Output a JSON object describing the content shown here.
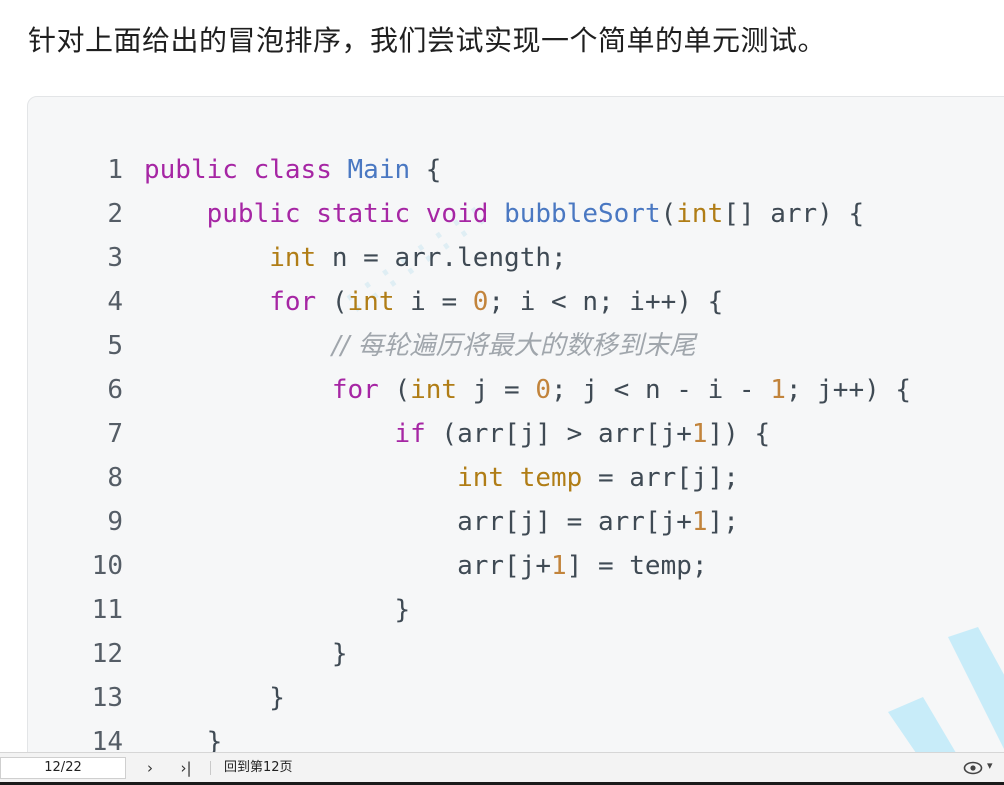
{
  "intro_text": "针对上面给出的冒泡排序，我们尝试实现一个简单的单元测试。",
  "code": {
    "lines": [
      {
        "num": "1"
      },
      {
        "num": "2"
      },
      {
        "num": "3"
      },
      {
        "num": "4"
      },
      {
        "num": "5"
      },
      {
        "num": "6"
      },
      {
        "num": "7"
      },
      {
        "num": "8"
      },
      {
        "num": "9"
      },
      {
        "num": "10"
      },
      {
        "num": "11"
      },
      {
        "num": "12"
      },
      {
        "num": "13"
      },
      {
        "num": "14"
      }
    ],
    "tokens": {
      "l1_public": "public",
      "l1_class": "class",
      "l1_main": "Main",
      "l1_brace": "{",
      "l2_public": "public",
      "l2_static": "static",
      "l2_void": "void",
      "l2_fn": "bubbleSort",
      "l2_paren_open": "(",
      "l2_int": "int",
      "l2_rest": "[] arr) {",
      "l3_int": "int",
      "l3_rest": "n = arr.length;",
      "l4_for": "for",
      "l4_a": "(",
      "l4_int": "int",
      "l4_b": "i = ",
      "l4_zero": "0",
      "l4_c": "; i < n; i++) {",
      "l5_comment": "// 每轮遍历将最大的数移到末尾",
      "l6_for": "for",
      "l6_a": "(",
      "l6_int": "int",
      "l6_b": "j = ",
      "l6_zero": "0",
      "l6_c": "; j < n - i - ",
      "l6_one": "1",
      "l6_d": "; j++) {",
      "l7_if": "if",
      "l7_a": "(arr[j] > arr[j+",
      "l7_one": "1",
      "l7_b": "]) {",
      "l8_int": "int",
      "l8_temp": "temp",
      "l8_rest": "= arr[j];",
      "l9_a": "arr[j] = arr[j+",
      "l9_one": "1",
      "l9_b": "];",
      "l10_a": "arr[j+",
      "l10_one": "1",
      "l10_b": "] = temp;",
      "l11": "}",
      "l12": "}",
      "l13": "}",
      "l14": "}"
    }
  },
  "statusbar": {
    "page_indicator": "12/22",
    "next_label": "›",
    "last_label": "›|",
    "goto_label": "回到第12页",
    "view_menu_caret": "▾"
  },
  "colors": {
    "keyword": "#a626a4",
    "class_name": "#4a78c2",
    "type": "#b07d16",
    "number": "#c2843c",
    "comment": "#a0a6ac",
    "code_bg": "#f6f7f8"
  }
}
